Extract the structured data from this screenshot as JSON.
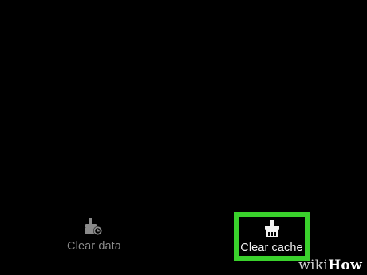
{
  "settings_actions": {
    "clear_data": {
      "label": "Clear data",
      "icon": "broom-clock-icon"
    },
    "clear_cache": {
      "label": "Clear cache",
      "icon": "broom-icon",
      "highlight_color": "#3ad12c"
    }
  },
  "watermark": {
    "part1": "wiki",
    "part2": "How"
  },
  "colors": {
    "background": "#000000",
    "inactive_text": "#8a8a8a",
    "active_text": "#f2f2f2"
  }
}
